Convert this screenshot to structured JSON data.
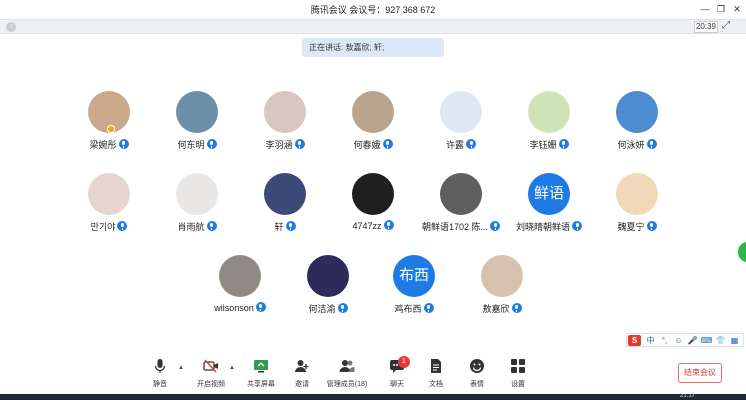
{
  "window": {
    "title": "腾讯会议 会议号：927 368 672",
    "controls": [
      "minimize",
      "restore",
      "close"
    ]
  },
  "status": {
    "clock": "20:39"
  },
  "speaking": {
    "text": "正在讲话: 敖嘉欣; 轩;"
  },
  "participants": [
    {
      "name": "梁婉彤",
      "avatar_color": "#c9a88c",
      "host": true
    },
    {
      "name": "何东明",
      "avatar_color": "#6d8fa8"
    },
    {
      "name": "李羽涵",
      "avatar_color": "#d9c6c0"
    },
    {
      "name": "何春娥",
      "avatar_color": "#b8a48f"
    },
    {
      "name": "许露",
      "avatar_color": "#dfe8f2"
    },
    {
      "name": "李钰姗",
      "avatar_color": "#cfe3b9"
    },
    {
      "name": "何泳妍",
      "avatar_color": "#4d8dcf"
    },
    {
      "name": "만기야",
      "avatar_color": "#e7d3d0"
    },
    {
      "name": "肖雨航",
      "avatar_color": "#e9e7e5"
    },
    {
      "name": "轩",
      "avatar_color": "#3c4a7a"
    },
    {
      "name": "4747zz",
      "avatar_color": "#1f1f1f"
    },
    {
      "name": "朝鲜语1702 陈...",
      "avatar_color": "#5f5f5f"
    },
    {
      "name": "刘晓晴朝鲜语",
      "avatar_color": "#1e7be6",
      "avatar_text": "鲜语"
    },
    {
      "name": "魏夏宁",
      "avatar_color": "#f2d7b9"
    },
    {
      "name": "wilsonson",
      "avatar_color": "#8f8a83"
    },
    {
      "name": "何洁渝",
      "avatar_color": "#2e2a5a"
    },
    {
      "name": "鸡布西",
      "avatar_color": "#1e7be6",
      "avatar_text": "布西"
    },
    {
      "name": "敖嘉欣",
      "avatar_color": "#d6c2ae"
    }
  ],
  "toolbar": {
    "items": [
      {
        "label": "静音",
        "icon": "microphone-icon"
      },
      {
        "label": "开启视频",
        "icon": "camera-off-icon"
      },
      {
        "label": "共享屏幕",
        "icon": "screen-share-icon"
      },
      {
        "label": "邀请",
        "icon": "invite-icon"
      },
      {
        "label": "管理成员(18)",
        "icon": "members-icon"
      },
      {
        "label": "聊天",
        "icon": "chat-icon"
      },
      {
        "label": "文档",
        "icon": "document-icon"
      },
      {
        "label": "表情",
        "icon": "emoji-icon"
      },
      {
        "label": "设置",
        "icon": "settings-icon"
      }
    ],
    "chat_badge": "1",
    "end_label": "结束会议"
  },
  "ime": {
    "logo": "S",
    "items": [
      "中",
      "°,",
      "☺",
      "🎤",
      "⌨",
      "👕",
      "▦"
    ]
  },
  "taskbar": {
    "clock": "21:17"
  }
}
